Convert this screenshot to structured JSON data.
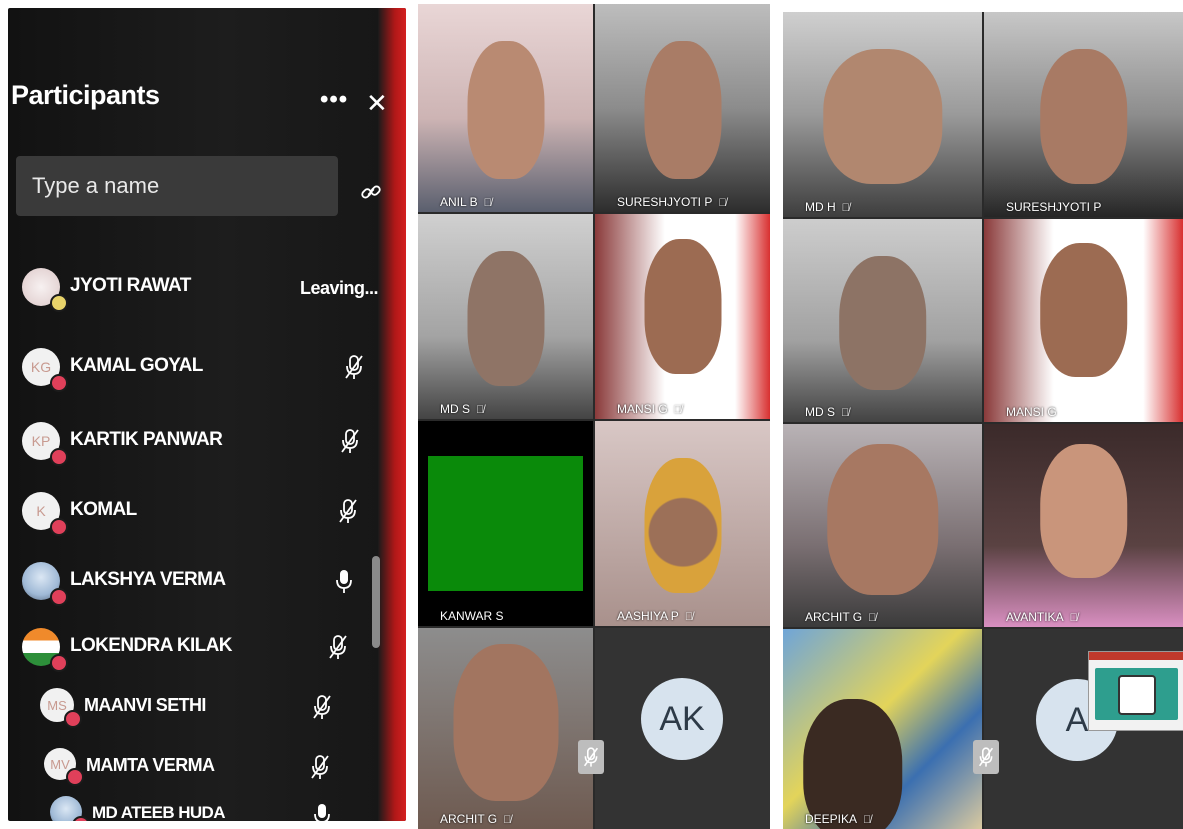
{
  "panel": {
    "title": "Participants",
    "more_label": "•••",
    "close_label": "✕",
    "search_placeholder": "Type a name",
    "participants": [
      {
        "name": "JYOTI RAWAT",
        "initials": "",
        "status_text": "Leaving...",
        "mic": "none"
      },
      {
        "name": "KAMAL GOYAL",
        "initials": "KG",
        "status_text": "",
        "mic": "muted"
      },
      {
        "name": "KARTIK PANWAR",
        "initials": "KP",
        "status_text": "",
        "mic": "muted"
      },
      {
        "name": "KOMAL",
        "initials": "K",
        "status_text": "",
        "mic": "muted"
      },
      {
        "name": "LAKSHYA VERMA",
        "initials": "",
        "status_text": "",
        "mic": "on"
      },
      {
        "name": "LOKENDRA KILAK",
        "initials": "",
        "status_text": "",
        "mic": "muted"
      },
      {
        "name": "MAANVI SETHI",
        "initials": "MS",
        "status_text": "",
        "mic": "muted"
      },
      {
        "name": "MAMTA VERMA",
        "initials": "MV",
        "status_text": "",
        "mic": "muted"
      },
      {
        "name": "MD ATEEB HUDA",
        "initials": "",
        "status_text": "",
        "mic": "on"
      }
    ]
  },
  "grid1": {
    "tiles": [
      {
        "label": "ANIL B",
        "muted": true
      },
      {
        "label": "SURESHJYOTI P",
        "muted": true
      },
      {
        "label": "MD S",
        "muted": true
      },
      {
        "label": "MANSI G",
        "muted": true
      },
      {
        "label": "KANWAR S",
        "muted": false
      },
      {
        "label": "AASHIYA P",
        "muted": true
      },
      {
        "label": "ARCHIT G",
        "muted": true
      },
      {
        "label": "",
        "muted": false,
        "initials": "AK"
      }
    ]
  },
  "grid2": {
    "tiles": [
      {
        "label": "MD H",
        "muted": true
      },
      {
        "label": "SURESHJYOTI P",
        "muted": false
      },
      {
        "label": "MD S",
        "muted": true
      },
      {
        "label": "MANSI G",
        "muted": false
      },
      {
        "label": "ARCHIT G",
        "muted": true
      },
      {
        "label": "AVANTIKA",
        "muted": true
      },
      {
        "label": "DEEPIKA",
        "muted": true
      },
      {
        "label": "",
        "muted": false,
        "initials": "A"
      }
    ]
  },
  "colors": {
    "panel_bg": "#1b1b1b",
    "status_red": "#e0405a",
    "status_yellow": "#e8d36a",
    "green_screen": "#0a8a0a"
  },
  "icons": {
    "more": "more-icon",
    "close": "close-icon",
    "link": "link-icon",
    "mic_muted": "mic-off-icon",
    "mic_on": "mic-icon"
  }
}
